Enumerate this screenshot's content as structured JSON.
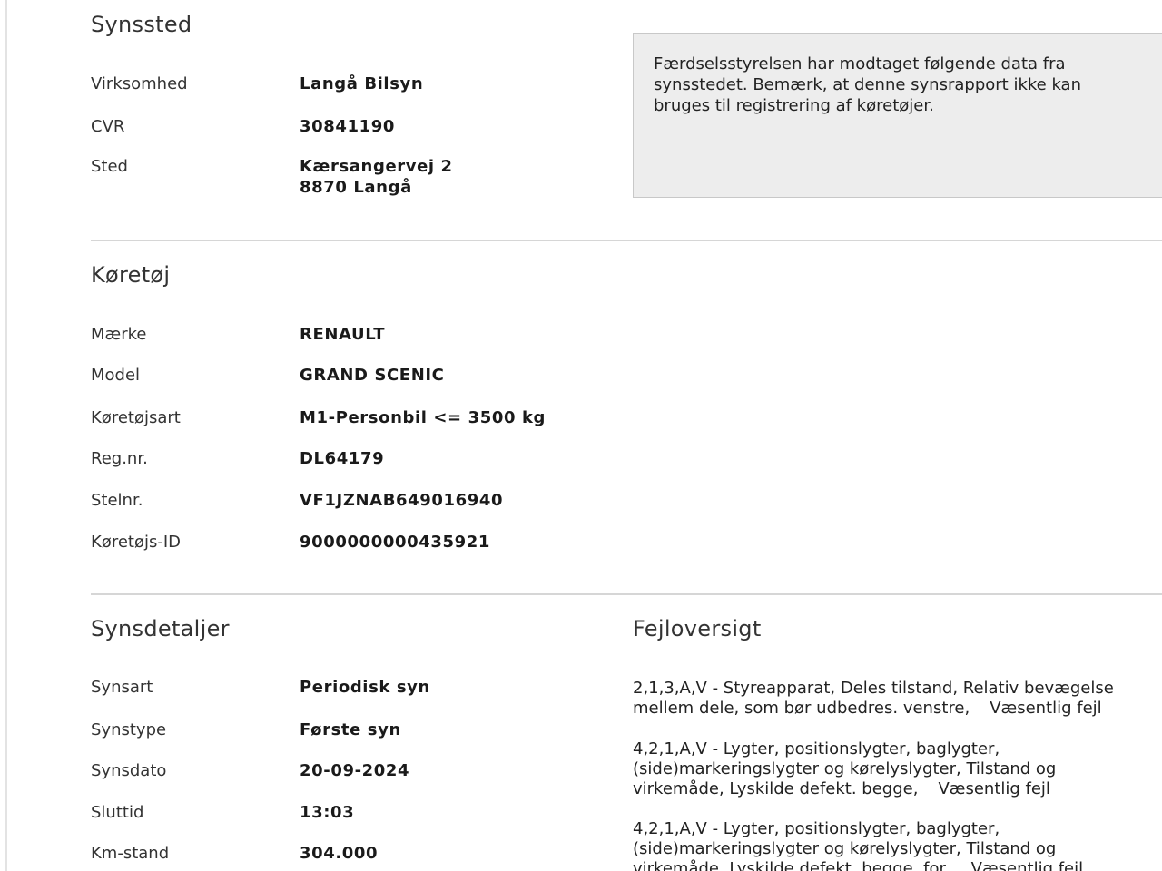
{
  "synssted": {
    "title": "Synssted",
    "fields": [
      {
        "label": "Virksomhed",
        "value": "Langå Bilsyn"
      },
      {
        "label": "CVR",
        "value": "30841190"
      },
      {
        "label": "Sted",
        "value": "Kærsangervej 2",
        "value2": "8870 Langå"
      }
    ],
    "info_text": "Færdselsstyrelsen har modtaget følgende data fra synsstedet. Bemærk, at denne synsrapport ikke kan bruges til registrering af køretøjer."
  },
  "koeretoej": {
    "title": "Køretøj",
    "fields": [
      {
        "label": "Mærke",
        "value": "RENAULT"
      },
      {
        "label": "Model",
        "value": "GRAND SCENIC"
      },
      {
        "label": "Køretøjsart",
        "value": "M1-Personbil <= 3500 kg"
      },
      {
        "label": "Reg.nr.",
        "value": "DL64179"
      },
      {
        "label": "Stelnr.",
        "value": "VF1JZNAB649016940"
      },
      {
        "label": "Køretøjs-ID",
        "value": "9000000000435921"
      }
    ]
  },
  "synsdetaljer": {
    "title": "Synsdetaljer",
    "fields": [
      {
        "label": "Synsart",
        "value": "Periodisk syn"
      },
      {
        "label": "Synstype",
        "value": "Første syn"
      },
      {
        "label": "Synsdato",
        "value": "20-09-2024"
      },
      {
        "label": "Sluttid",
        "value": "13:03"
      },
      {
        "label": "Km-stand",
        "value": "304.000"
      }
    ]
  },
  "fejloversigt": {
    "title": "Fejloversigt",
    "items": [
      {
        "text": "2,1,3,A,V - Styreapparat, Deles tilstand, Relativ bevægelse mellem dele, som bør udbedres. venstre,",
        "severity": "Væsentlig fejl"
      },
      {
        "text": "4,2,1,A,V - Lygter, positionslygter, baglygter, (side)markeringslygter og kørelyslygter, Tilstand og virkemåde, Lyskilde defekt. begge,",
        "severity": "Væsentlig fejl"
      },
      {
        "text": "4,2,1,A,V - Lygter, positionslygter, baglygter, (side)markeringslygter og kørelyslygter, Tilstand og virkemåde, Lyskilde defekt. begge, for,",
        "severity": "Væsentlig fejl"
      }
    ]
  }
}
